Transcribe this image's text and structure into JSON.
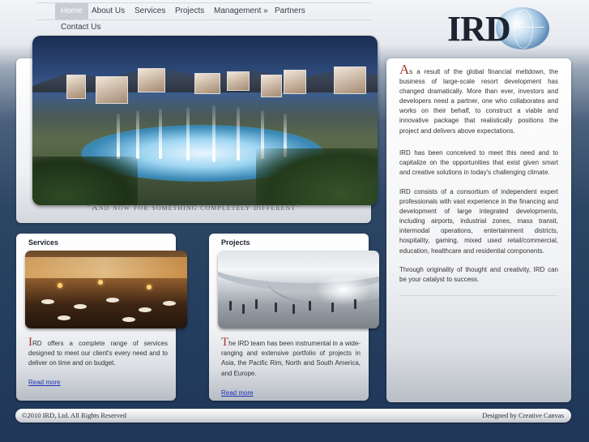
{
  "nav": {
    "items": [
      {
        "label": "Home",
        "active": true
      },
      {
        "label": "About Us"
      },
      {
        "label": "Services"
      },
      {
        "label": "Projects"
      },
      {
        "label": "Management »"
      },
      {
        "label": "Partners"
      }
    ],
    "contact": "Contact Us"
  },
  "logo": {
    "text": "IRD",
    "icon": "globe-icon"
  },
  "hero": {
    "tagline": "“And now for something completely different”"
  },
  "intro": {
    "p1_cap": "A",
    "p1_rest": "s a result of the global financial meltdown, the business of large-scale resort development has changed dramatically. More than ever, investors and developers need a partner, one who collaborates and works on their behalf, to construct a viable and innovative package that realistically positions the project and delivers above expectations.",
    "p2": "IRD has been conceived to meet this need and to capitalize on the opportunities that exist given smart and creative solutions in today's challenging climate.",
    "p3": "IRD consists of a consortium of independent expert professionals with vast experience in the financing and development of large integrated developments, including airports, industrial zones, mass transit, intermodal operations, entertainment districts, hospitality, gaming, mixed used retail/commercial, education, healthcare and residential components.",
    "p4": "Through originality of thought and creativity, IRD can be your catalyst to success."
  },
  "services": {
    "title": "Services",
    "cap": "I",
    "text": "RD offers a complete range of services designed to meet our client's every need and to deliver on time and on budget.",
    "read_more": "Read more"
  },
  "projects": {
    "title": "Projects",
    "cap": "T",
    "text": "he IRD team has been instrumental in a wide-ranging and extensive portfolio of projects in Asia, the Pacific Rim, North and South America, and Europe.",
    "read_more": "Read more"
  },
  "footer": {
    "copyright": "©2010 IRD, Ltd. All Rights Reserved",
    "credit": "Designed by Creative Canvas"
  }
}
